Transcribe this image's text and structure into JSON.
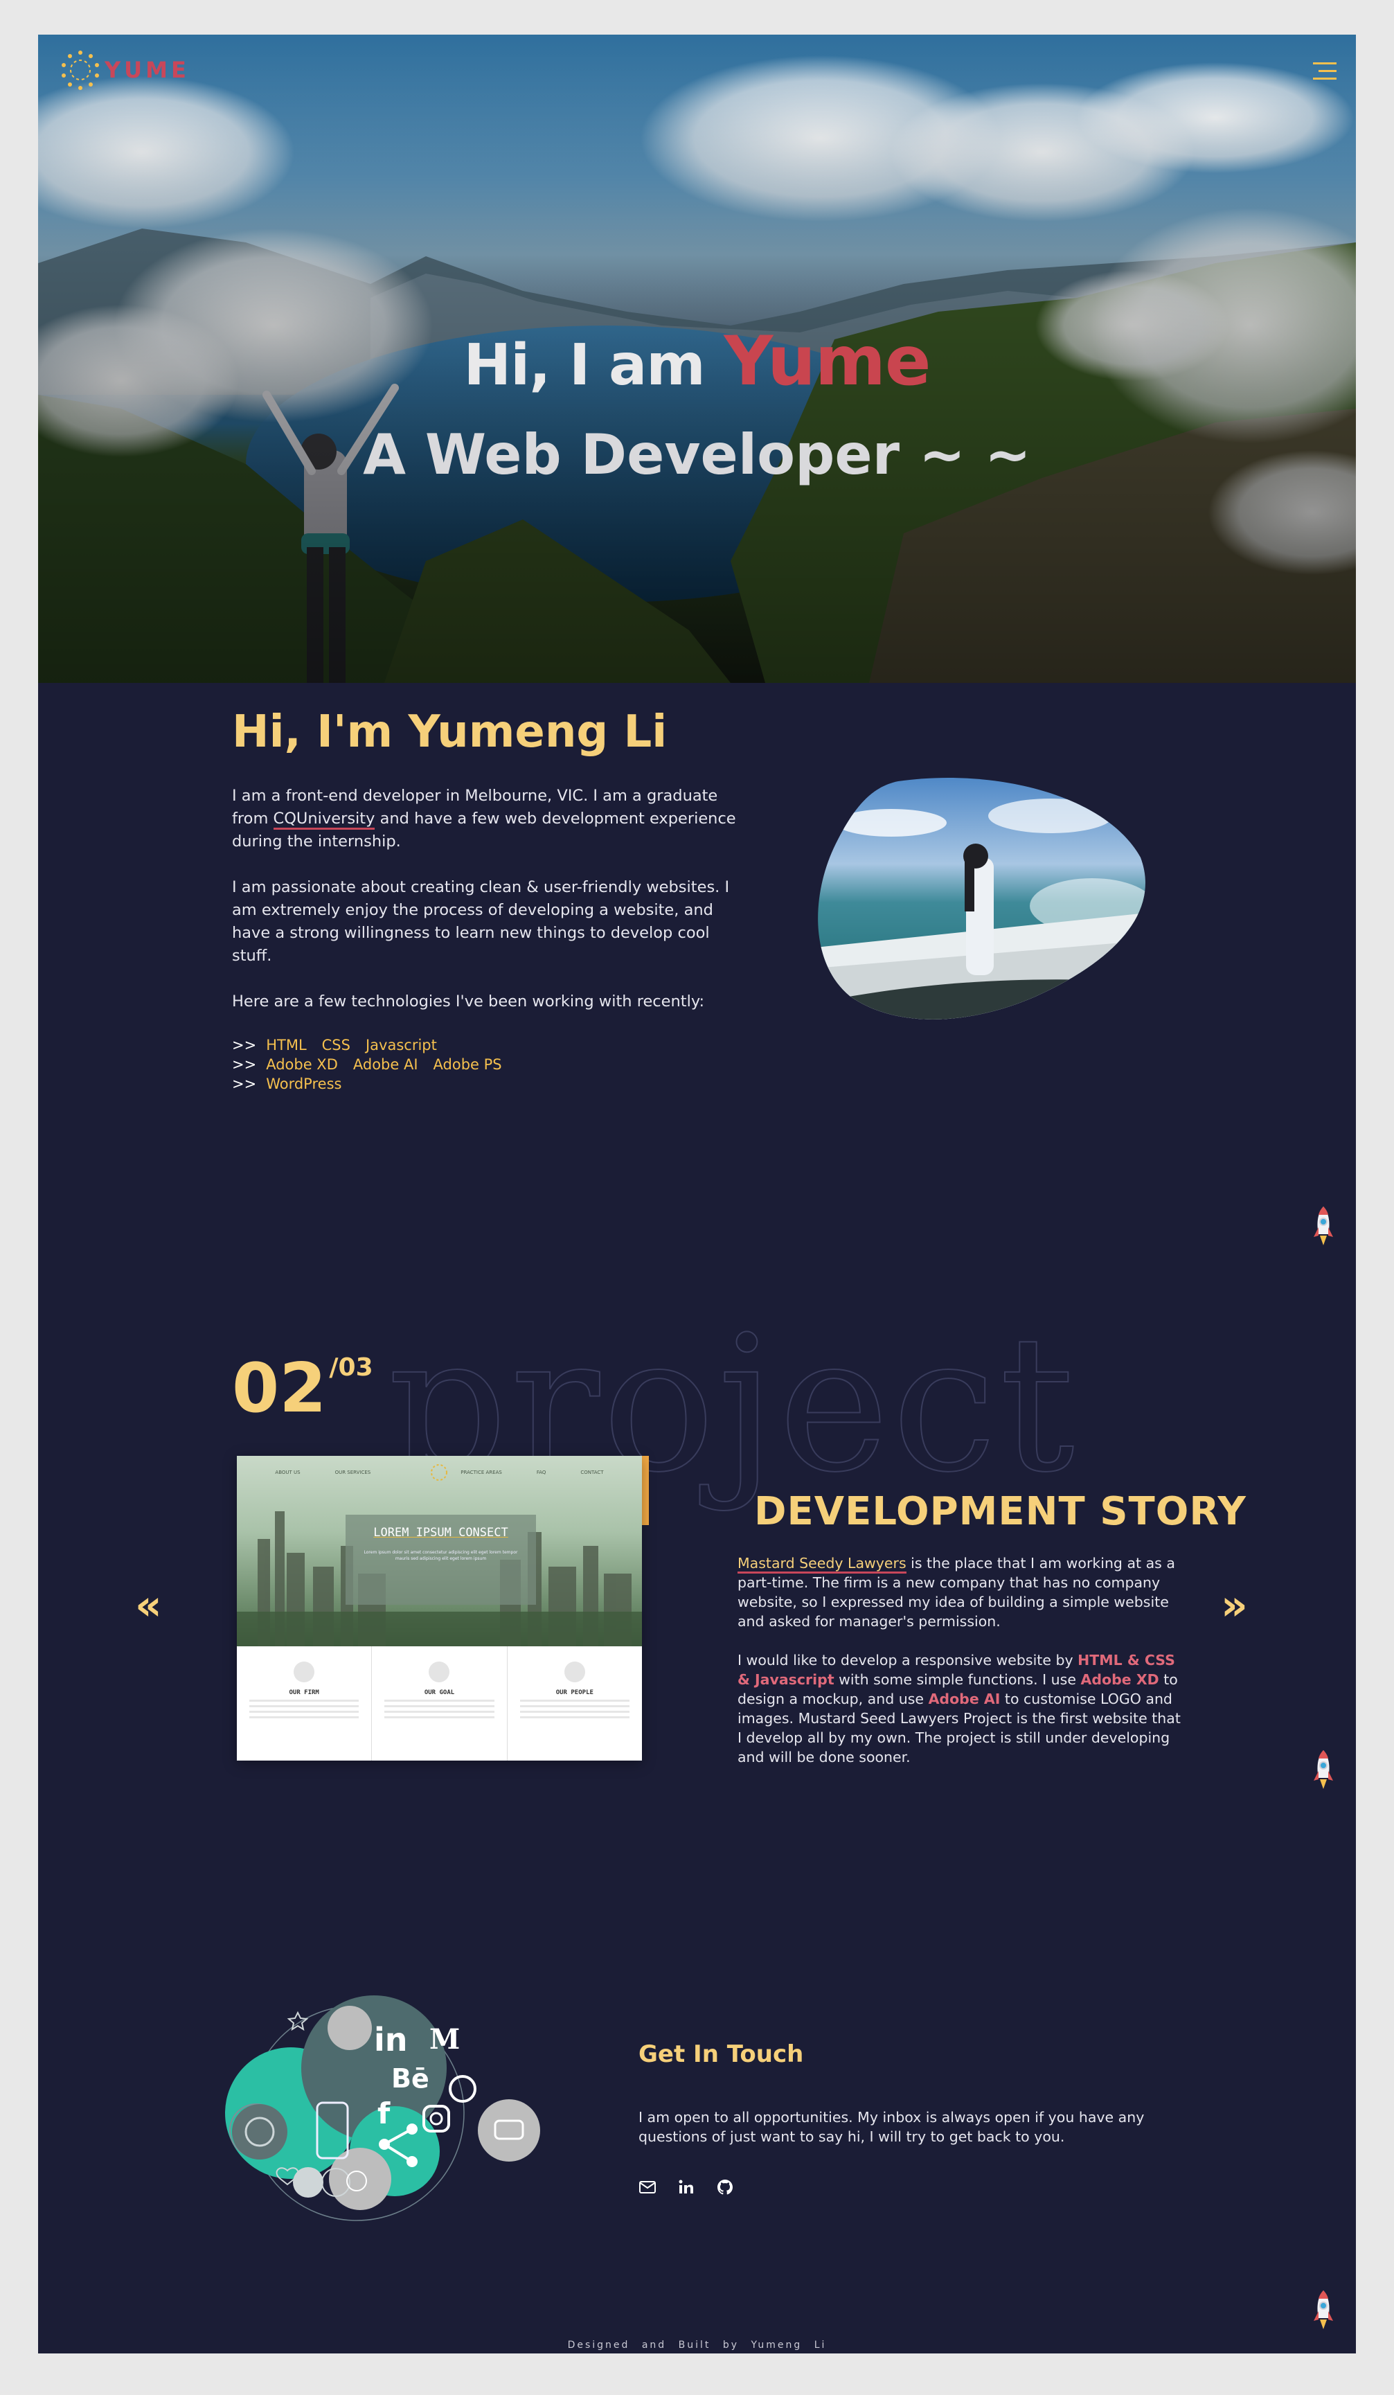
{
  "header": {
    "logo_text": "YUME",
    "menu_icon": "hamburger-icon"
  },
  "hero": {
    "greeting": "Hi, I am ",
    "name": "Yume",
    "subtitle": "A Web Developer ~ ~"
  },
  "about": {
    "title": "Hi, I'm Yumeng Li",
    "p1_before": "I am a front-end developer in Melbourne, VIC. I am a graduate from ",
    "p1_link": "CQUniversity",
    "p1_after": " and have a few web development experience during the internship.",
    "p2": "I am passionate about creating clean & user-friendly websites. I am extremely enjoy the process of developing a website, and have a strong willingness to learn new things to develop cool stuff.",
    "p3": "Here are a few technologies I've been working with recently:",
    "arrow": ">>",
    "tech_rows": [
      [
        "HTML",
        "CSS",
        "Javascript"
      ],
      [
        "Adobe XD",
        "Adobe AI",
        "Adobe PS"
      ],
      [
        "WordPress"
      ]
    ]
  },
  "projects": {
    "current": "02",
    "total": "/03",
    "ghost_word": "project",
    "prev_arrow": "«",
    "next_arrow": "»",
    "screenshot": {
      "nav": [
        "ABOUT US",
        "OUR SERVICES",
        "PRACTICE AREAS",
        "FAQ",
        "CONTACT"
      ],
      "title": "LOREM IPSUM CONSECT",
      "subtitle": "Lorem ipsum dolor sit amet consectetur adipiscing elit eget lorem tempor mauris sed adipiscing elit eget lorem ipsum",
      "columns": [
        "OUR FIRM",
        "OUR GOAL",
        "OUR PEOPLE"
      ]
    },
    "dev_title": "DEVELOPMENT STORY",
    "p1_link": "Mastard Seedy Lawyers",
    "p1_after": " is the place that I am working at as a part-time. The firm is a new company that has no company website, so I expressed my idea of building a simple website and asked for manager's permission.",
    "p2_a": "I would like to develop a responsive website by ",
    "p2_hl1": "HTML & CSS & Javascript",
    "p2_b": " with some simple functions. I use ",
    "p2_hl2": "Adobe XD",
    "p2_c": " to design a mockup, and use ",
    "p2_hl3": "Adobe AI",
    "p2_d": " to customise LOGO and images. Mustard Seed Lawyers Project is the first website that I develop all by my own. The project is still under developing and will be done sooner."
  },
  "contact": {
    "title": "Get In Touch",
    "text": "I am open to all opportunities. My inbox is always open if you have any questions of just want to say hi, I will try to get back to you.",
    "icons": [
      "email-icon",
      "linkedin-icon",
      "github-icon"
    ],
    "art_labels": [
      "in",
      "M",
      "Bē",
      "f"
    ]
  },
  "footer": {
    "text": "Designed and Built by Yumeng Li"
  },
  "colors": {
    "background": "#1b1d36",
    "accent_yellow": "#f6d07a",
    "accent_red": "#c8475a",
    "teal": "#2bbfa4"
  }
}
